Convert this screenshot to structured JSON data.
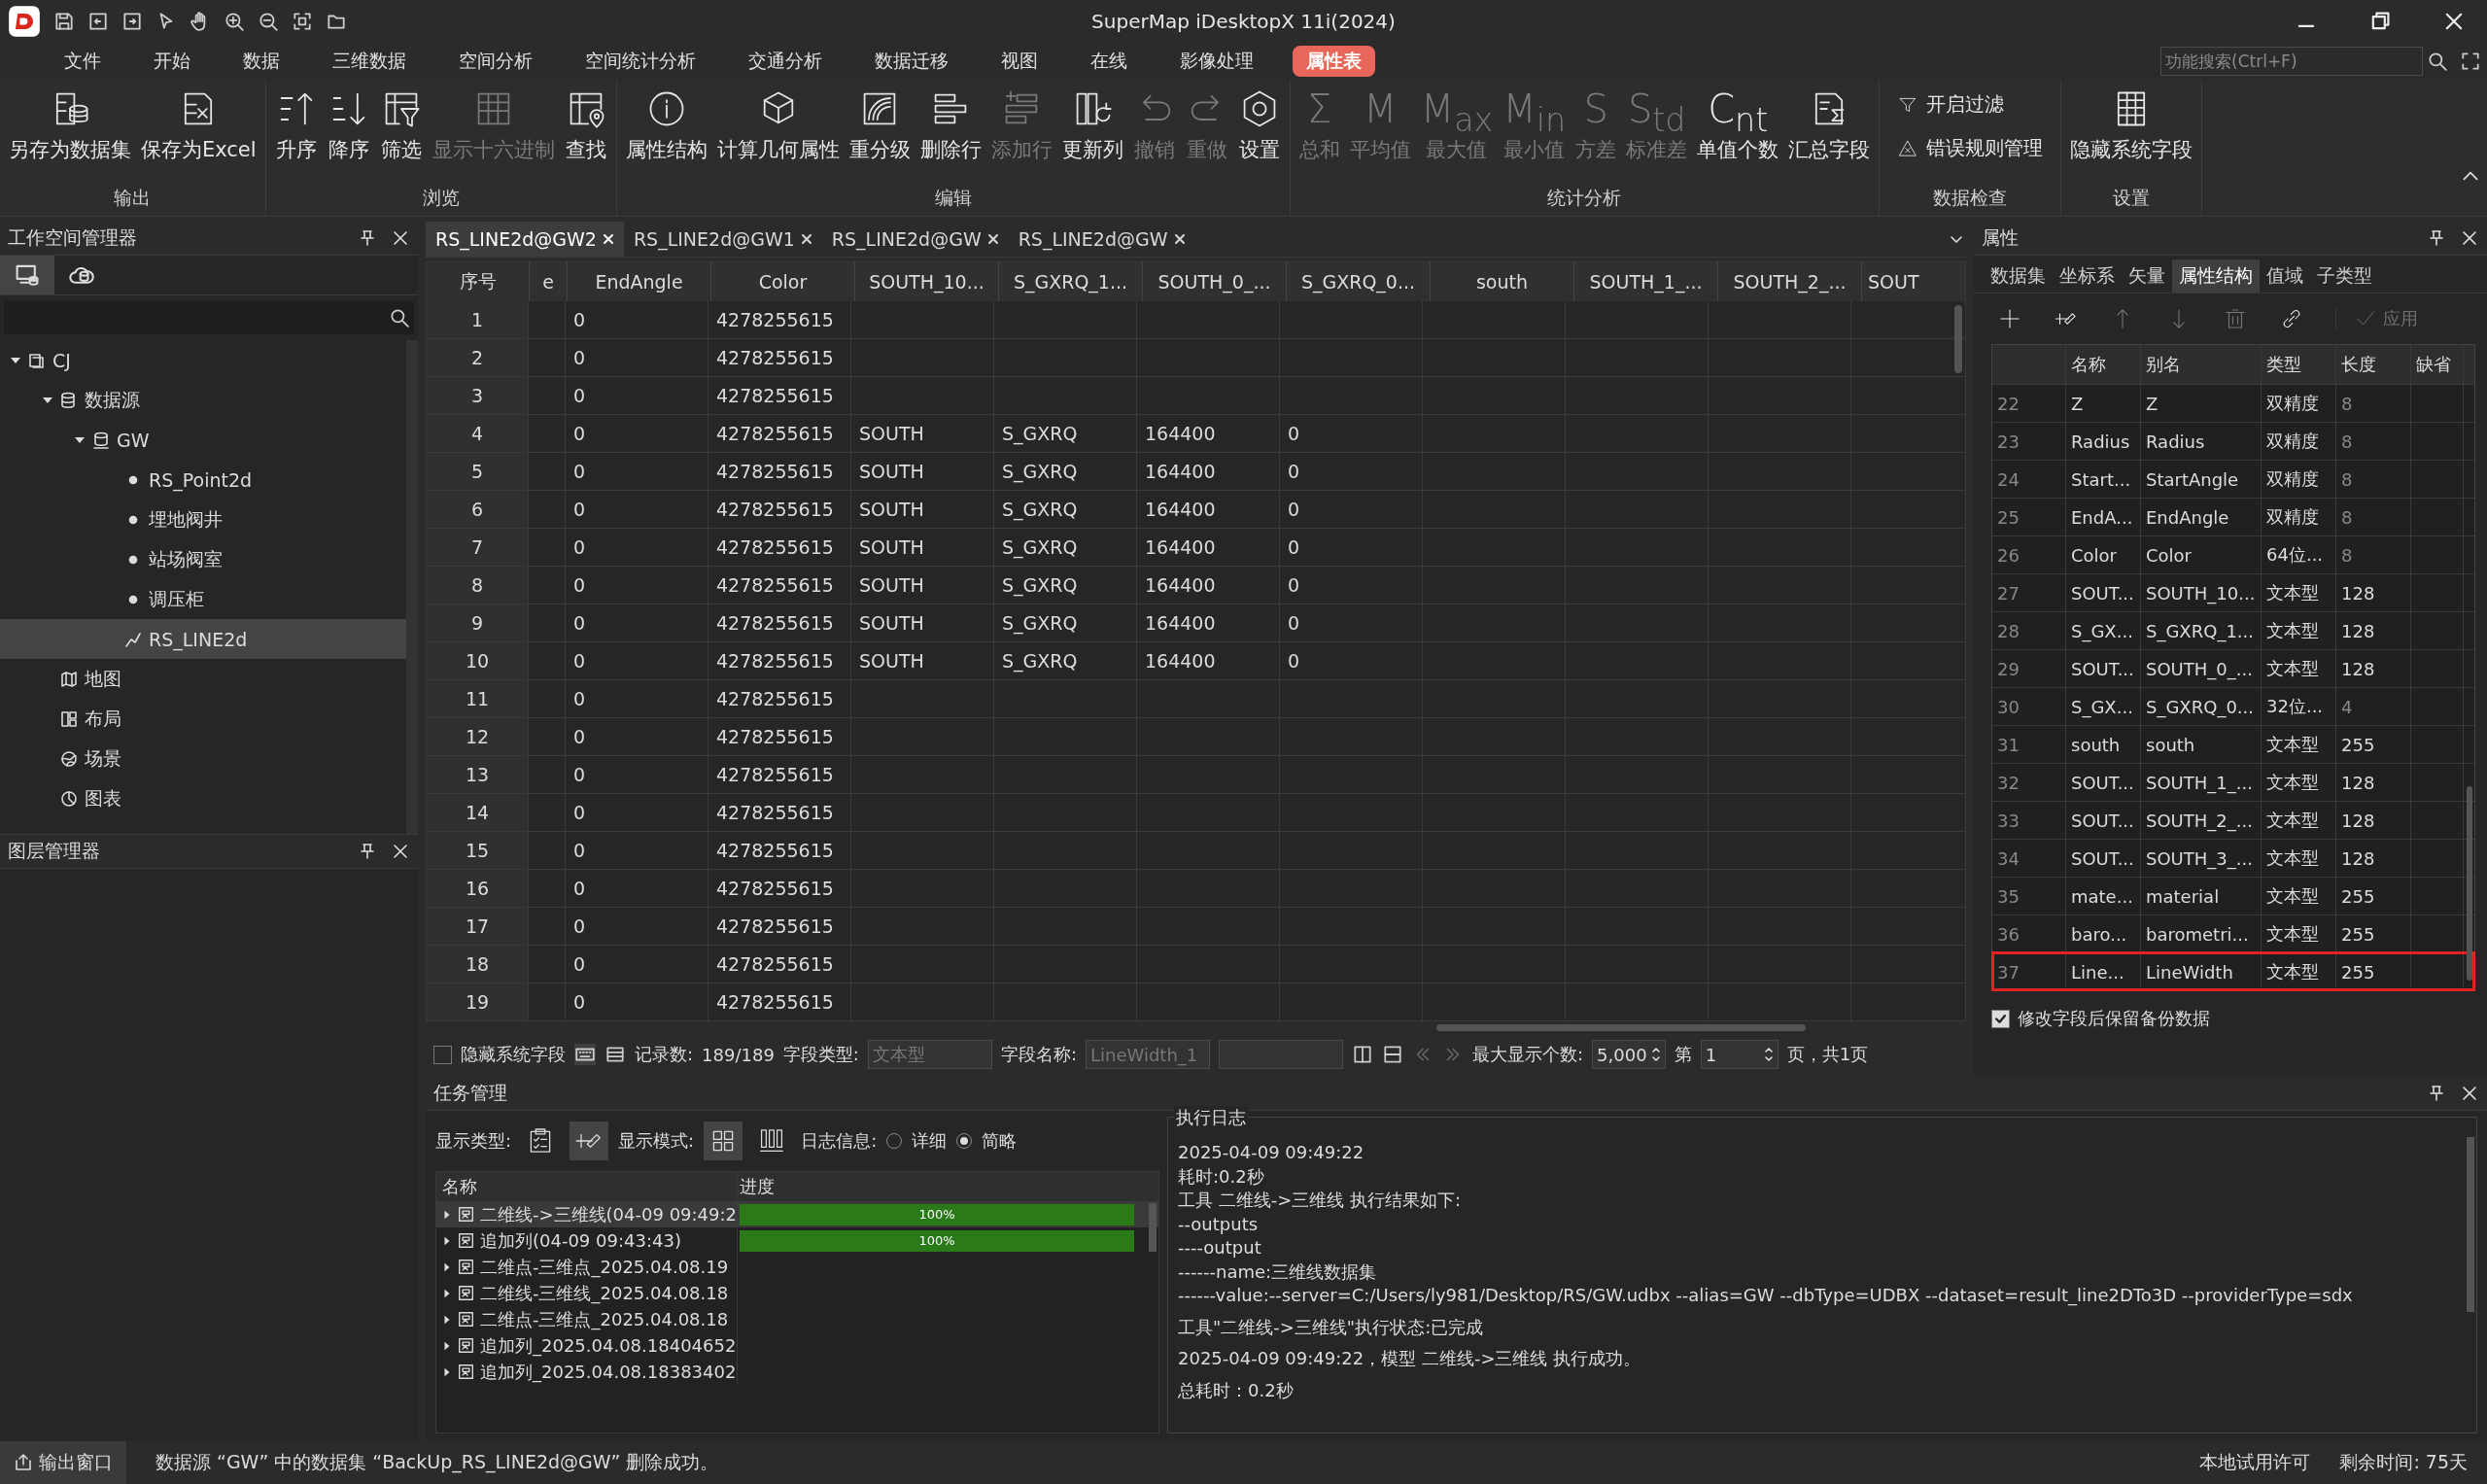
{
  "window": {
    "title": "SuperMap iDesktopX 11i(2024)"
  },
  "menu_tabs": [
    {
      "label": "文件",
      "selected": false
    },
    {
      "label": "开始",
      "selected": false
    },
    {
      "label": "数据",
      "selected": false
    },
    {
      "label": "三维数据",
      "selected": false
    },
    {
      "label": "空间分析",
      "selected": false
    },
    {
      "label": "空间统计分析",
      "selected": false
    },
    {
      "label": "交通分析",
      "selected": false
    },
    {
      "label": "数据迁移",
      "selected": false
    },
    {
      "label": "视图",
      "selected": false
    },
    {
      "label": "在线",
      "selected": false
    },
    {
      "label": "影像处理",
      "selected": false
    },
    {
      "label": "属性表",
      "selected": true
    }
  ],
  "search": {
    "placeholder": "功能搜索(Ctrl+F)"
  },
  "ribbon_groups": [
    {
      "label": "输出",
      "buttons": [
        {
          "kind": "dataset",
          "label": "另存为数据集",
          "disabled": false
        },
        {
          "kind": "excel",
          "label": "保存为Excel",
          "disabled": false
        }
      ]
    },
    {
      "label": "浏览",
      "buttons": [
        {
          "kind": "ascending",
          "label": "升序",
          "disabled": false
        },
        {
          "kind": "descending",
          "label": "降序",
          "disabled": false
        },
        {
          "kind": "filter",
          "label": "筛选",
          "disabled": false
        },
        {
          "kind": "hex",
          "label": "显示十六进制",
          "disabled": true
        },
        {
          "kind": "find",
          "label": "查找",
          "disabled": false
        }
      ]
    },
    {
      "label": "编辑",
      "buttons": [
        {
          "kind": "info",
          "label": "属性结构",
          "disabled": false
        },
        {
          "kind": "geometry",
          "label": "计算几何属性",
          "disabled": false
        },
        {
          "kind": "reclass",
          "label": "重分级",
          "disabled": false
        },
        {
          "kind": "deleterow",
          "label": "删除行",
          "disabled": false
        },
        {
          "kind": "addrow",
          "label": "添加行",
          "disabled": true
        },
        {
          "kind": "updatecolumn",
          "label": "更新列",
          "disabled": false
        },
        {
          "kind": "undo",
          "label": "撤销",
          "disabled": true
        },
        {
          "kind": "redo",
          "label": "重做",
          "disabled": true
        },
        {
          "kind": "settings",
          "label": "设置",
          "disabled": false
        }
      ]
    },
    {
      "label": "统计分析",
      "buttons": [
        {
          "kind": "glyph",
          "glyph": "Σ",
          "label": "总和",
          "disabled": true
        },
        {
          "kind": "glyph",
          "glyph": "M",
          "label": "平均值",
          "disabled": true
        },
        {
          "kind": "glyph",
          "glyph": "M$_{ax}$",
          "label": "最大值",
          "disabled": true
        },
        {
          "kind": "glyph",
          "glyph": "M$_{in}$",
          "label": "最小值",
          "disabled": true
        },
        {
          "kind": "glyph",
          "glyph": "S",
          "label": "方差",
          "disabled": true
        },
        {
          "kind": "glyph",
          "glyph": "S$_{td}$",
          "label": "标准差",
          "disabled": true
        },
        {
          "kind": "glyph",
          "glyph": "C$_{nt}$",
          "label": "单值个数",
          "disabled": false
        },
        {
          "kind": "summary",
          "label": "汇总字段",
          "disabled": false
        }
      ]
    },
    {
      "label": "数据检查",
      "buttons": [
        {
          "kind": "funnel",
          "label": "开启过滤",
          "disabled": false
        },
        {
          "kind": "rules",
          "label": "错误规则管理",
          "disabled": false
        }
      ]
    },
    {
      "label": "设置",
      "buttons": [
        {
          "kind": "table",
          "label": "隐藏系统字段",
          "disabled": false
        }
      ]
    }
  ],
  "workspace_panel": {
    "title": "工作空间管理器",
    "tree": [
      {
        "kind": "workspace",
        "label": "CJ",
        "expanded": true,
        "selected": false,
        "children": [
          {
            "kind": "datasource",
            "label": "数据源",
            "expanded": true,
            "selected": false,
            "children": [
              {
                "kind": "udbx",
                "label": "GW",
                "expanded": true,
                "selected": false,
                "children": [
                  {
                    "kind": "point",
                    "label": "RS_Point2d",
                    "selected": false
                  },
                  {
                    "kind": "point",
                    "label": "埋地阀井",
                    "selected": false
                  },
                  {
                    "kind": "point",
                    "label": "站场阀室",
                    "selected": false
                  },
                  {
                    "kind": "point",
                    "label": "调压柜",
                    "selected": false
                  },
                  {
                    "kind": "line",
                    "label": "RS_LINE2d",
                    "selected": true
                  }
                ]
              }
            ]
          },
          {
            "kind": "map",
            "label": "地图",
            "selected": false
          },
          {
            "kind": "layout",
            "label": "布局",
            "selected": false
          },
          {
            "kind": "scene",
            "label": "场景",
            "selected": false
          },
          {
            "kind": "chart",
            "label": "图表",
            "selected": false
          }
        ]
      }
    ]
  },
  "layer_panel": {
    "title": "图层管理器"
  },
  "doc_tabs": [
    {
      "label": "RS_LINE2d@GW2",
      "selected": true
    },
    {
      "label": "RS_LINE2d@GW1",
      "selected": false
    },
    {
      "label": "RS_LINE2d@GW",
      "selected": false
    },
    {
      "label": "RS_LINE2d@GW",
      "selected": false
    }
  ],
  "table": {
    "columns": [
      "序号",
      "e",
      "EndAngle",
      "Color",
      "SOUTH_10...",
      "S_GXRQ_1...",
      "SOUTH_0_...",
      "S_GXRQ_0...",
      "south",
      "SOUTH_1_...",
      "SOUTH_2_...",
      "SOUT"
    ],
    "rows": [
      [
        "1",
        null,
        "0",
        "4278255615"
      ],
      [
        "2",
        null,
        "0",
        "4278255615"
      ],
      [
        "3",
        null,
        "0",
        "4278255615"
      ],
      [
        "4",
        null,
        "0",
        "4278255615",
        "SOUTH",
        "S_GXRQ",
        "164400",
        "0"
      ],
      [
        "5",
        null,
        "0",
        "4278255615",
        "SOUTH",
        "S_GXRQ",
        "164400",
        "0"
      ],
      [
        "6",
        null,
        "0",
        "4278255615",
        "SOUTH",
        "S_GXRQ",
        "164400",
        "0"
      ],
      [
        "7",
        null,
        "0",
        "4278255615",
        "SOUTH",
        "S_GXRQ",
        "164400",
        "0"
      ],
      [
        "8",
        null,
        "0",
        "4278255615",
        "SOUTH",
        "S_GXRQ",
        "164400",
        "0"
      ],
      [
        "9",
        null,
        "0",
        "4278255615",
        "SOUTH",
        "S_GXRQ",
        "164400",
        "0"
      ],
      [
        "10",
        null,
        "0",
        "4278255615",
        "SOUTH",
        "S_GXRQ",
        "164400",
        "0"
      ],
      [
        "11",
        null,
        "0",
        "4278255615"
      ],
      [
        "12",
        null,
        "0",
        "4278255615"
      ],
      [
        "13",
        null,
        "0",
        "4278255615"
      ],
      [
        "14",
        null,
        "0",
        "4278255615"
      ],
      [
        "15",
        null,
        "0",
        "4278255615"
      ],
      [
        "16",
        null,
        "0",
        "4278255615"
      ],
      [
        "17",
        null,
        "0",
        "4278255615"
      ],
      [
        "18",
        null,
        "0",
        "4278255615"
      ],
      [
        "19",
        null,
        "0",
        "4278255615"
      ]
    ]
  },
  "table_footer": {
    "hide_system_fields": {
      "label": "隐藏系统字段",
      "checked": false
    },
    "record_label": "记录数:",
    "record_count": "189/189",
    "field_type_label": "字段类型:",
    "field_type_value": "文本型",
    "field_name_label": "字段名称:",
    "field_name_value": "LineWidth_1",
    "max_label": "最大显示个数:",
    "max_value": "5,000",
    "page_label": "第",
    "page_value": "1",
    "page_suffix": "页，共1页"
  },
  "properties_panel": {
    "title": "属性",
    "tabs": [
      {
        "label": "数据集",
        "selected": false
      },
      {
        "label": "坐标系",
        "selected": false
      },
      {
        "label": "矢量",
        "selected": false
      },
      {
        "label": "属性结构",
        "selected": true
      },
      {
        "label": "值域",
        "selected": false
      },
      {
        "label": "子类型",
        "selected": false
      }
    ],
    "tools": [
      {
        "kind": "add",
        "disabled": false
      },
      {
        "kind": "edit",
        "disabled": false
      },
      {
        "kind": "up",
        "disabled": true
      },
      {
        "kind": "down",
        "disabled": true
      },
      {
        "kind": "delete",
        "disabled": true
      },
      {
        "kind": "link",
        "disabled": false
      }
    ],
    "apply_button": {
      "label": "应用",
      "disabled": true
    },
    "columns": [
      "名称",
      "别名",
      "类型",
      "长度",
      "缺省"
    ],
    "fields": [
      {
        "index": "22",
        "name": "Z",
        "alias": "Z",
        "type": "双精度",
        "length": "8",
        "length_editable": false,
        "annotated": false
      },
      {
        "index": "23",
        "name": "Radius",
        "alias": "Radius",
        "type": "双精度",
        "length": "8",
        "length_editable": false,
        "annotated": false
      },
      {
        "index": "24",
        "name": "Start...",
        "alias": "StartAngle",
        "type": "双精度",
        "length": "8",
        "length_editable": false,
        "annotated": false
      },
      {
        "index": "25",
        "name": "EndA...",
        "alias": "EndAngle",
        "type": "双精度",
        "length": "8",
        "length_editable": false,
        "annotated": false
      },
      {
        "index": "26",
        "name": "Color",
        "alias": "Color",
        "type": "64位...",
        "length": "8",
        "length_editable": false,
        "annotated": false
      },
      {
        "index": "27",
        "name": "SOUT...",
        "alias": "SOUTH_10...",
        "type": "文本型",
        "length": "128",
        "length_editable": true,
        "annotated": false
      },
      {
        "index": "28",
        "name": "S_GX...",
        "alias": "S_GXRQ_1...",
        "type": "文本型",
        "length": "128",
        "length_editable": true,
        "annotated": false
      },
      {
        "index": "29",
        "name": "SOUT...",
        "alias": "SOUTH_0_...",
        "type": "文本型",
        "length": "128",
        "length_editable": true,
        "annotated": false
      },
      {
        "index": "30",
        "name": "S_GX...",
        "alias": "S_GXRQ_0...",
        "type": "32位...",
        "length": "4",
        "length_editable": false,
        "annotated": false
      },
      {
        "index": "31",
        "name": "south",
        "alias": "south",
        "type": "文本型",
        "length": "255",
        "length_editable": true,
        "annotated": false
      },
      {
        "index": "32",
        "name": "SOUT...",
        "alias": "SOUTH_1_...",
        "type": "文本型",
        "length": "128",
        "length_editable": true,
        "annotated": false
      },
      {
        "index": "33",
        "name": "SOUT...",
        "alias": "SOUTH_2_...",
        "type": "文本型",
        "length": "128",
        "length_editable": true,
        "annotated": false
      },
      {
        "index": "34",
        "name": "SOUT...",
        "alias": "SOUTH_3_...",
        "type": "文本型",
        "length": "128",
        "length_editable": true,
        "annotated": false
      },
      {
        "index": "35",
        "name": "mate...",
        "alias": "material",
        "type": "文本型",
        "length": "255",
        "length_editable": true,
        "annotated": false
      },
      {
        "index": "36",
        "name": "baro...",
        "alias": "barometri...",
        "type": "文本型",
        "length": "255",
        "length_editable": true,
        "annotated": false
      },
      {
        "index": "37",
        "name": "Line...",
        "alias": "LineWidth",
        "type": "文本型",
        "length": "255",
        "length_editable": true,
        "annotated": true
      }
    ],
    "backup_checkbox": {
      "label": "修改字段后保留备份数据",
      "checked": true
    }
  },
  "task_panel": {
    "title": "任务管理",
    "display_type_label": "显示类型:",
    "display_types": [
      {
        "kind": "checklist",
        "selected": false
      },
      {
        "kind": "edit",
        "selected": true
      }
    ],
    "display_mode_label": "显示模式:",
    "display_modes": [
      {
        "kind": "tiles",
        "selected": true
      },
      {
        "kind": "bars",
        "selected": false
      }
    ],
    "log_label": "日志信息:",
    "log_options": [
      {
        "label": "详细",
        "selected": false
      },
      {
        "label": "简略",
        "selected": true
      }
    ],
    "columns": [
      "名称",
      "进度"
    ],
    "tasks": [
      {
        "name": "二维线->三维线(04-09 09:49:2",
        "selected": true,
        "progress": "100%",
        "level": 1
      },
      {
        "name": "追加列(04-09 09:43:43)",
        "selected": false,
        "progress": "100%",
        "level": 1
      },
      {
        "name": "二维点-三维点_2025.04.08.19",
        "selected": false
      },
      {
        "name": "二维线-三维线_2025.04.08.18",
        "selected": false
      },
      {
        "name": "二维点-三维点_2025.04.08.18",
        "selected": false
      },
      {
        "name": "追加列_2025.04.08.18404652",
        "selected": false
      },
      {
        "name": "追加列_2025.04.08.18383402",
        "selected": false
      }
    ],
    "log_title": "执行日志",
    "log_lines": [
      "2025-04-09 09:49:22",
      "耗时:0.2秒",
      "工具 二维线->三维线 执行结果如下:",
      "--outputs",
      "----output",
      "------name:三维线数据集",
      "------value:--server=C:/Users/ly981/Desktop/RS/GW.udbx --alias=GW --dbType=UDBX --dataset=result_line2DTo3D --providerType=sdx",
      "工具\"二维线->三维线\"执行状态:已完成",
      "2025-04-09 09:49:22，模型 二维线->三维线 执行成功。",
      "总耗时：0.2秒"
    ]
  },
  "status_bar": {
    "output_button": "输出窗口",
    "message": "数据源 “GW” 中的数据集 “BackUp_RS_LINE2d@GW” 删除成功。",
    "license": "本地试用许可",
    "remaining": "剩余时间: 75天"
  }
}
